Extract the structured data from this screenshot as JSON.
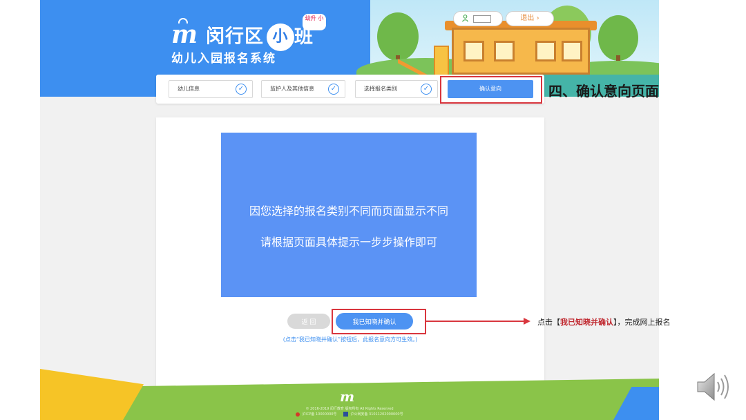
{
  "header": {
    "logo_brand": "闵行区",
    "logo_small": "小",
    "logo_class": "班",
    "logo_bubble": "幼升 小",
    "system_title": "幼儿入园报名系统",
    "logout_label": "退出 ›"
  },
  "steps": [
    {
      "label": "幼儿信息",
      "state": "done"
    },
    {
      "label": "监护人及其他信息",
      "state": "done"
    },
    {
      "label": "选择报名类别",
      "state": "done"
    },
    {
      "label": "确认意向",
      "state": "active"
    }
  ],
  "notice": {
    "line1": "因您选择的报名类别不同而页面显示不同",
    "line2": "请根据页面具体提示一步步操作即可"
  },
  "actions": {
    "back_label": "返 回",
    "confirm_label": "我已知晓并确认",
    "hint": "(点击“我已知晓并确认”按钮后，此报名意向方可生效。)"
  },
  "footer": {
    "copyright": "© 2016-2019 闵行教育 版权所有 All Rights Reserved",
    "icp": "沪ICP备 10000000号",
    "police": "沪公网安备 31011202000000号"
  },
  "annotations": {
    "section_title": "四、确认意向页面",
    "note_prefix": "点击【",
    "note_emphasis": "我已知晓并确认",
    "note_suffix": "】，完成网上报名"
  },
  "colors": {
    "brand_blue": "#3d8ff0",
    "notice_blue": "#5b93f5",
    "annotation_red": "#d9363e",
    "footer_green": "#8ac449"
  },
  "icons": [
    "user-icon",
    "check-circle-icon",
    "speaker-icon",
    "site-logo-icon"
  ]
}
